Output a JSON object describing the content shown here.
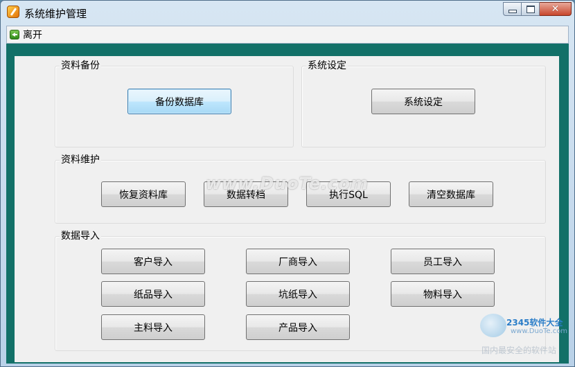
{
  "window": {
    "title": "系统维护管理"
  },
  "toolbar": {
    "exit_label": "离开"
  },
  "groups": {
    "backup": {
      "title": "资料备份",
      "backup_db": "备份数据库"
    },
    "settings": {
      "title": "系统设定",
      "system_settings": "系统设定"
    },
    "maintenance": {
      "title": "资料维护",
      "restore_db": "恢复资料库",
      "data_convert": "数据转档",
      "exec_sql": "执行SQL",
      "clear_db": "清空数据库"
    },
    "import": {
      "title": "数据导入",
      "customer": "客户导入",
      "vendor": "厂商导入",
      "employee": "员工导入",
      "paper": "纸品导入",
      "corrugated": "坑纸导入",
      "material": "物料导入",
      "main_material": "主料导入",
      "product": "产品导入"
    }
  },
  "watermark": {
    "text": "www.DuoTe.com"
  },
  "logo": {
    "brand": "2345软件大全",
    "url": "www.DuoTe.com",
    "tagline": "国内最安全的软件站"
  }
}
